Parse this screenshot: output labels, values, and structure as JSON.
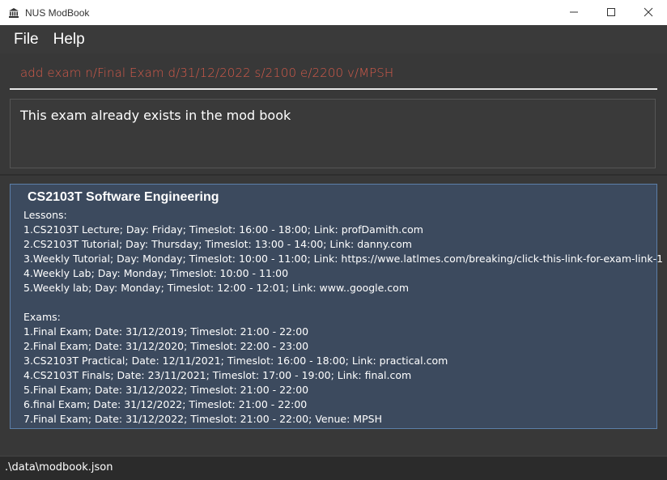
{
  "window": {
    "title": "NUS ModBook",
    "controls": [
      "minimize-icon",
      "maximize-icon",
      "close-icon"
    ]
  },
  "menu": {
    "items": [
      "File",
      "Help"
    ]
  },
  "command_box": {
    "value": "add exam n/Final Exam d/31/12/2022 s/2100 e/2200 v/MPSH"
  },
  "result": {
    "message": "This exam already exists in the mod book"
  },
  "module": {
    "title": "CS2103T Software Engineering",
    "lessons_header": "Lessons:",
    "lessons": [
      "1.CS2103T Lecture; Day: Friday; Timeslot: 16:00 - 18:00; Link: profDamith.com",
      "2.CS2103T Tutorial; Day: Thursday; Timeslot: 13:00 - 14:00; Link: danny.com",
      "3.Weekly Tutorial; Day: Monday; Timeslot: 10:00 - 11:00; Link: https://wwe.latlmes.com/breaking/click-this-link-for-exam-link-1",
      "4.Weekly Lab; Day: Monday; Timeslot: 10:00 - 11:00",
      "5.Weekly lab; Day: Monday; Timeslot: 12:00 - 12:01; Link: www..google.com"
    ],
    "exams_header": "Exams:",
    "exams": [
      "1.Final Exam; Date: 31/12/2019; Timeslot: 21:00 - 22:00",
      "2.Final Exam; Date: 31/12/2020; Timeslot: 22:00 - 23:00",
      "3.CS2103T Practical; Date: 12/11/2021; Timeslot: 16:00 - 18:00; Link: practical.com",
      "4.CS2103T Finals; Date: 23/11/2021; Timeslot: 17:00 - 19:00; Link: final.com",
      "5.Final Exam; Date: 31/12/2022; Timeslot: 21:00 - 22:00",
      "6.final Exam; Date: 31/12/2022; Timeslot: 21:00 - 22:00",
      "7.Final Exam; Date: 31/12/2022; Timeslot: 21:00 - 22:00; Venue: MPSH"
    ]
  },
  "status": {
    "path": ".\\data\\modbook.json"
  },
  "colors": {
    "command_text": "#d35a4a",
    "card_bg": "#3c4a5e",
    "card_border": "#5c7fa8",
    "app_bg": "#383838"
  }
}
